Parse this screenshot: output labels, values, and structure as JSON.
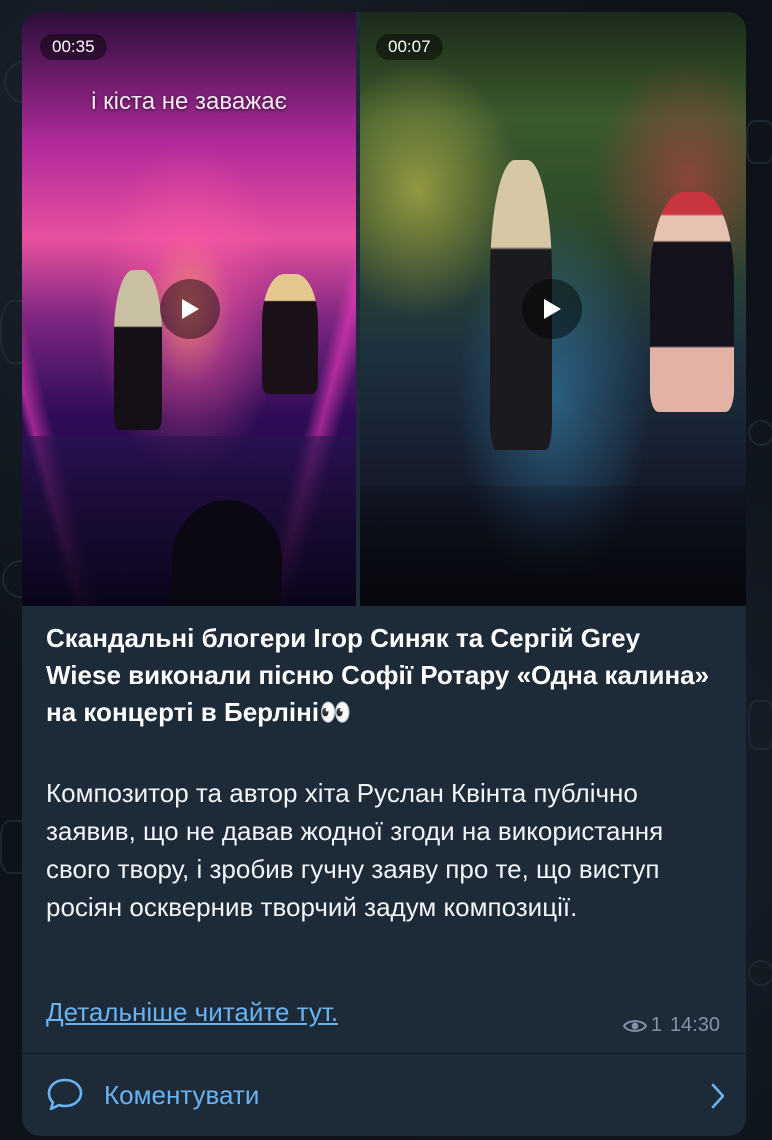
{
  "post": {
    "videos": [
      {
        "duration": "00:35",
        "overlay_text": "і кіста не заважає"
      },
      {
        "duration": "00:07"
      }
    ],
    "title": "Скандальні блогери Ігор Синяк та Сергій Grey Wiese виконали пісню Софії Ротару «Одна калина» на концерті в Берліні👀",
    "body": "Композитор та автор хіта Руслан Квінта публічно заявив, що не давав жодної згоди на використання свого твору, і зробив гучну заяву про те, що виступ росіян осквернив творчий задум композиції.",
    "link_text": "Детальніше читайте тут.",
    "views": "1",
    "time": "14:30"
  },
  "comments": {
    "label": "Коментувати"
  },
  "icons": {
    "play": "play-icon",
    "views": "eye-icon",
    "comment": "comment-bubble-icon",
    "chevron": "chevron-right-icon"
  },
  "colors": {
    "bubble_bg": "#1d2a38",
    "link": "#6ab3f3",
    "meta": "#8394a6",
    "background": "#0e131a"
  }
}
